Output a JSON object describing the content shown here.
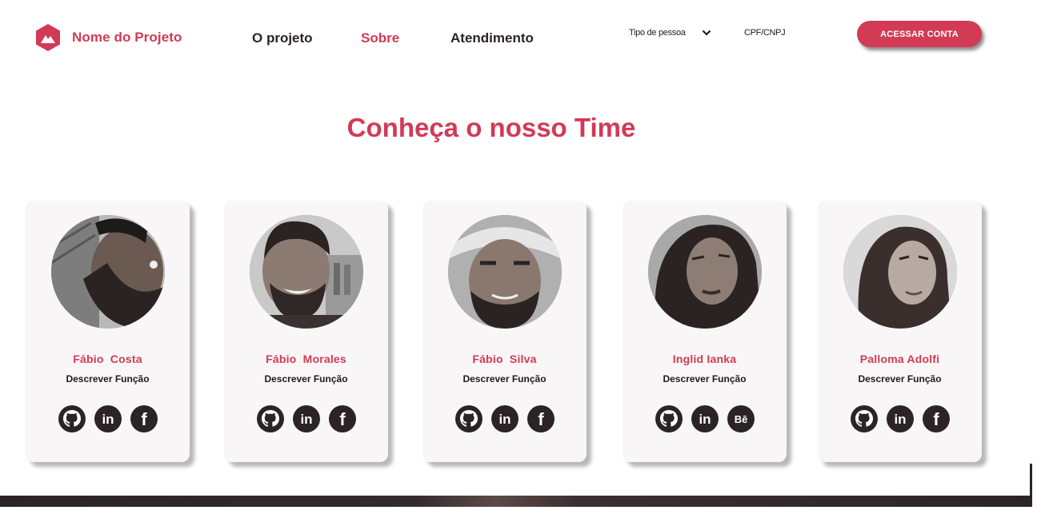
{
  "brand": {
    "name": "Nome do Projeto",
    "logo_icon": "mountain-hexagon-icon"
  },
  "nav": {
    "items": [
      "O projeto",
      "Sobre",
      "Atendimento"
    ],
    "active": "Sobre"
  },
  "filters": {
    "tipo_label": "Tipo de pessoa",
    "doc_label": "CPF/CNPJ"
  },
  "cta": {
    "label": "ACESSAR CONTA"
  },
  "section": {
    "title": "Conheça o nosso Time"
  },
  "team": [
    {
      "name": "Fábio  Costa",
      "role": "Descrever Função",
      "socials": [
        "github-icon",
        "linkedin-icon",
        "facebook-icon"
      ]
    },
    {
      "name": "Fábio  Morales",
      "role": "Descrever Função",
      "socials": [
        "github-icon",
        "linkedin-icon",
        "facebook-icon"
      ]
    },
    {
      "name": "Fábio  Silva",
      "role": "Descrever Função",
      "socials": [
        "github-icon",
        "linkedin-icon",
        "facebook-icon"
      ]
    },
    {
      "name": "Inglid Ianka",
      "role": "Descrever Função",
      "socials": [
        "github-icon",
        "linkedin-icon",
        "behance-icon"
      ]
    },
    {
      "name": "Palloma Adolfi",
      "role": "Descrever Função",
      "socials": [
        "github-icon",
        "linkedin-icon",
        "facebook-icon"
      ]
    }
  ],
  "colors": {
    "accent": "#d23a55",
    "dark": "#2b2325",
    "card": "#f9f6f7"
  }
}
